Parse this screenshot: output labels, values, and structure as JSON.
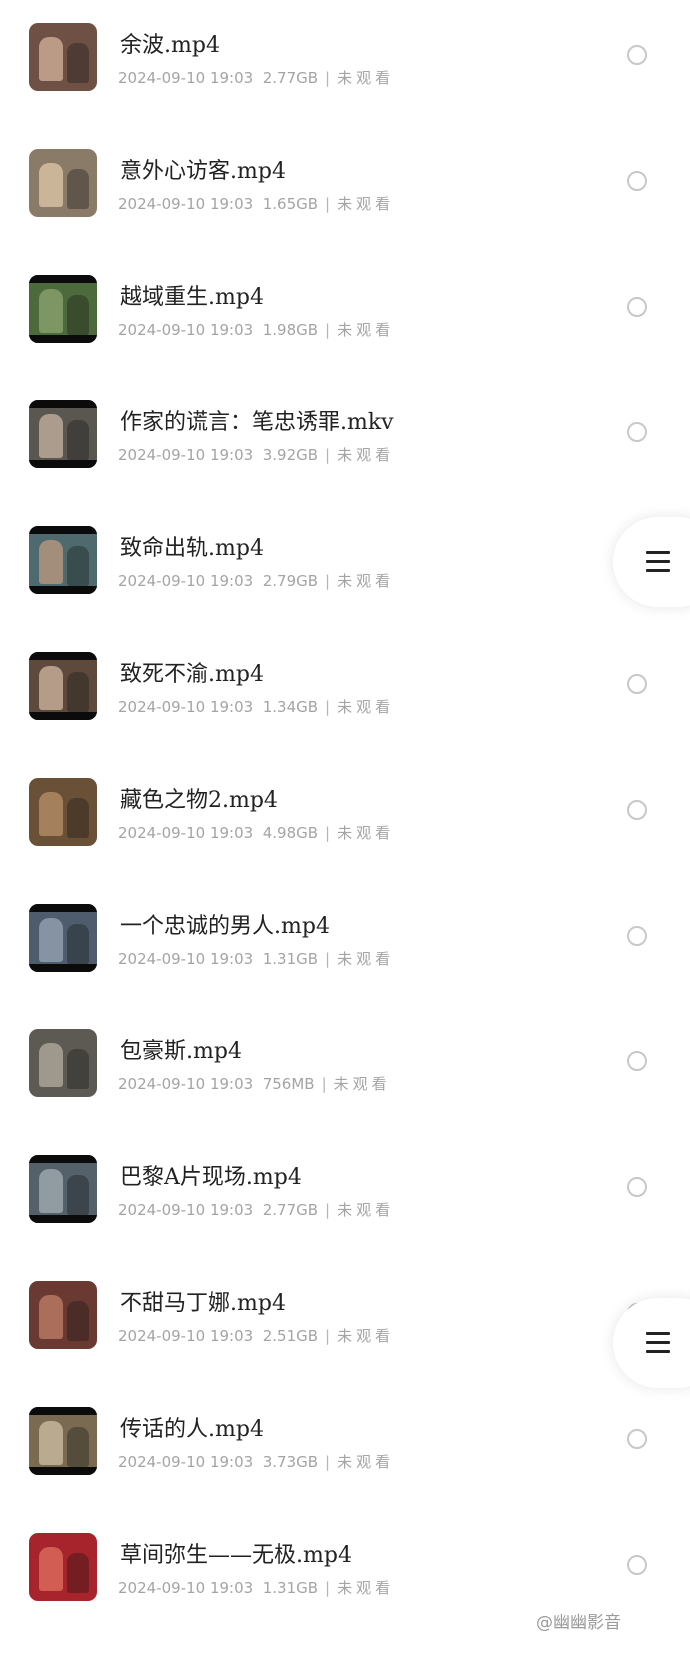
{
  "files": [
    {
      "title": "余波.mp4",
      "date": "2024-09-10 19:03",
      "size": "2.77GB",
      "status": "未观看",
      "thumb": {
        "bg": "#6e5044",
        "accent": "#d6b49c",
        "bars": false
      }
    },
    {
      "title": "意外心访客.mp4",
      "date": "2024-09-10 19:03",
      "size": "1.65GB",
      "status": "未观看",
      "thumb": {
        "bg": "#8a7a68",
        "accent": "#e0c9a8",
        "bars": false
      }
    },
    {
      "title": "越域重生.mp4",
      "date": "2024-09-10 19:03",
      "size": "1.98GB",
      "status": "未观看",
      "thumb": {
        "bg": "#4d6a3c",
        "accent": "#8fa570",
        "bars": true
      }
    },
    {
      "title": "作家的谎言：笔忠诱罪.mkv",
      "date": "2024-09-10 19:03",
      "size": "3.92GB",
      "status": "未观看",
      "thumb": {
        "bg": "#5a5650",
        "accent": "#c8b4a2",
        "bars": true
      }
    },
    {
      "title": "致命出轨.mp4",
      "date": "2024-09-10 19:03",
      "size": "2.79GB",
      "status": "未观看",
      "thumb": {
        "bg": "#4e6a6e",
        "accent": "#c09a80",
        "bars": true
      }
    },
    {
      "title": "致死不渝.mp4",
      "date": "2024-09-10 19:03",
      "size": "1.34GB",
      "status": "未观看",
      "thumb": {
        "bg": "#5e4a3c",
        "accent": "#d2b8a2",
        "bars": true
      }
    },
    {
      "title": "藏色之物2.mp4",
      "date": "2024-09-10 19:03",
      "size": "4.98GB",
      "status": "未观看",
      "thumb": {
        "bg": "#6a5036",
        "accent": "#b8926a",
        "bars": false
      }
    },
    {
      "title": "一个忠诚的男人.mp4",
      "date": "2024-09-10 19:03",
      "size": "1.31GB",
      "status": "未观看",
      "thumb": {
        "bg": "#4e5c6e",
        "accent": "#9aa6b4",
        "bars": true
      }
    },
    {
      "title": "包豪斯.mp4",
      "date": "2024-09-10 19:03",
      "size": "756MB",
      "status": "未观看",
      "thumb": {
        "bg": "#5c5a52",
        "accent": "#b6ada0",
        "bars": false
      }
    },
    {
      "title": "巴黎A片现场.mp4",
      "date": "2024-09-10 19:03",
      "size": "2.77GB",
      "status": "未观看",
      "thumb": {
        "bg": "#54606a",
        "accent": "#a6b0b6",
        "bars": true
      }
    },
    {
      "title": "不甜马丁娜.mp4",
      "date": "2024-09-10 19:03",
      "size": "2.51GB",
      "status": "未观看",
      "thumb": {
        "bg": "#6a3a32",
        "accent": "#c28068",
        "bars": false
      }
    },
    {
      "title": "传话的人.mp4",
      "date": "2024-09-10 19:03",
      "size": "3.73GB",
      "status": "未观看",
      "thumb": {
        "bg": "#7a6a52",
        "accent": "#d0c2a6",
        "bars": true
      }
    },
    {
      "title": "草间弥生——无极.mp4",
      "date": "2024-09-10 19:03",
      "size": "1.31GB",
      "status": "未观看",
      "thumb": {
        "bg": "#a8242c",
        "accent": "#e07060",
        "bars": false
      }
    }
  ],
  "menu_icon": "menu-icon",
  "watermark": "@幽幽影音"
}
